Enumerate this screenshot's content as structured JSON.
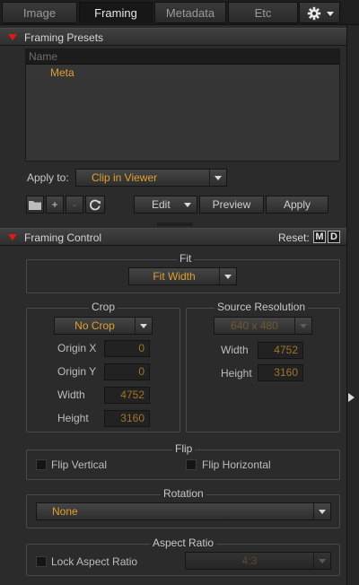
{
  "tabs": [
    "Image",
    "Framing",
    "Metadata",
    "Etc"
  ],
  "framing_presets": {
    "title": "Framing Presets",
    "list_header": "Name",
    "items": [
      "Meta"
    ],
    "apply_to_label": "Apply to:",
    "apply_to_value": "Clip in Viewer",
    "add_label": "+",
    "remove_label": "-",
    "edit_label": "Edit",
    "preview_label": "Preview",
    "apply_label": "Apply"
  },
  "framing_control": {
    "title": "Framing Control",
    "reset_label": "Reset:",
    "reset_m": "M",
    "reset_d": "D",
    "fit": {
      "title": "Fit",
      "value": "Fit Width"
    },
    "crop": {
      "title": "Crop",
      "mode": "No Crop",
      "origin_x_label": "Origin X",
      "origin_x": "0",
      "origin_y_label": "Origin Y",
      "origin_y": "0",
      "width_label": "Width",
      "width": "4752",
      "height_label": "Height",
      "height": "3160"
    },
    "source_resolution": {
      "title": "Source Resolution",
      "value": "640 x 480",
      "width_label": "Width",
      "width": "4752",
      "height_label": "Height",
      "height": "3160"
    },
    "flip": {
      "title": "Flip",
      "vertical": "Flip Vertical",
      "horizontal": "Flip Horizontal"
    },
    "rotation": {
      "title": "Rotation",
      "value": "None"
    },
    "aspect_ratio": {
      "title": "Aspect Ratio",
      "lock_label": "Lock Aspect Ratio",
      "value": "4:3"
    }
  },
  "colors": {
    "accent": "#e0a030",
    "triangle": "#e01818",
    "background": "#2b2b2b"
  }
}
